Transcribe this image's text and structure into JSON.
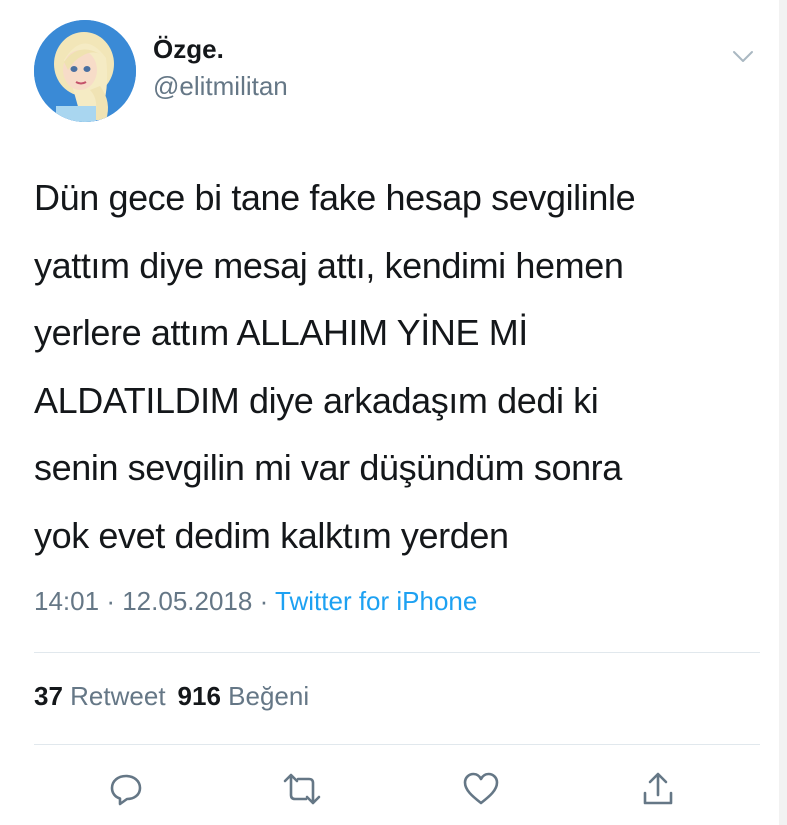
{
  "author": {
    "display_name": "Özge.",
    "handle": "@elitmilitan",
    "avatar_icon": "avatar-elsa"
  },
  "tweet": {
    "lines": [
      "Dün gece bi tane fake hesap sevgilinle",
      "yattım diye mesaj attı, kendimi hemen",
      "yerlere attım ALLAHIM YİNE Mİ",
      "ALDATILDIM diye arkadaşım dedi ki",
      "senin sevgilin mi var düşündüm sonra",
      "yok evet dedim kalktım yerden"
    ]
  },
  "meta": {
    "time": "14:01",
    "separator": "·",
    "date": "12.05.2018",
    "source": "Twitter for iPhone"
  },
  "stats": {
    "retweet_count": "37",
    "retweet_label": "Retweet",
    "like_count": "916",
    "like_label": "Beğeni"
  },
  "actions": [
    "reply-icon",
    "retweet-icon",
    "like-icon",
    "share-icon"
  ],
  "colors": {
    "text": "#14171a",
    "secondary": "#657786",
    "link": "#1da1f2",
    "divider": "#e1e8ed"
  }
}
